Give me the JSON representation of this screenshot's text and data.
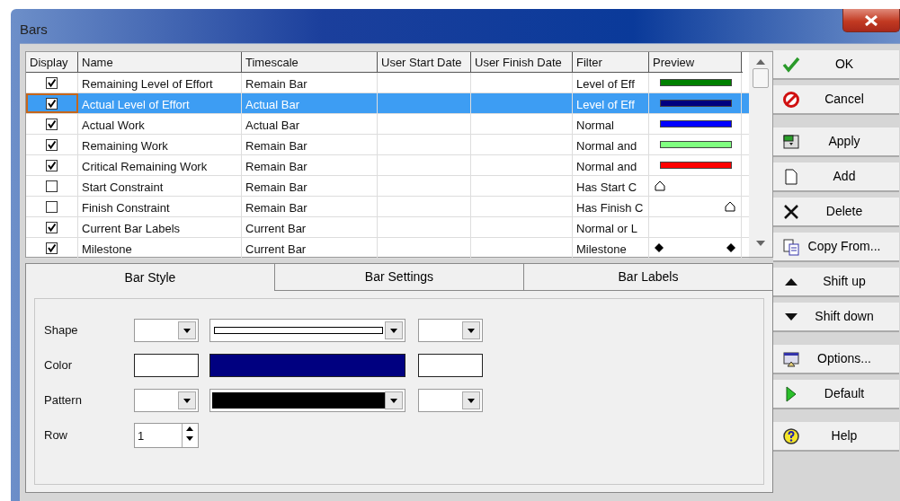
{
  "window": {
    "title": "Bars"
  },
  "table": {
    "columns": [
      "Display",
      "Name",
      "Timescale",
      "User Start Date",
      "User Finish Date",
      "Filter",
      "Preview"
    ],
    "rows": [
      {
        "display": true,
        "selected": false,
        "focused": false,
        "name": "Remaining Level of Effort",
        "timescale": "Remain Bar",
        "filter": "Level of Eff",
        "preview": {
          "kind": "bar",
          "color": "#008000"
        }
      },
      {
        "display": true,
        "selected": true,
        "focused": true,
        "name": "Actual Level of Effort",
        "timescale": "Actual Bar",
        "filter": "Level of Eff",
        "preview": {
          "kind": "bar",
          "color": "#000080"
        }
      },
      {
        "display": true,
        "selected": false,
        "focused": false,
        "name": "Actual Work",
        "timescale": "Actual Bar",
        "filter": "Normal",
        "preview": {
          "kind": "bar",
          "color": "#0000ff"
        }
      },
      {
        "display": true,
        "selected": false,
        "focused": false,
        "name": "Remaining Work",
        "timescale": "Remain Bar",
        "filter": "Normal and",
        "preview": {
          "kind": "bar",
          "color": "#80ff80"
        }
      },
      {
        "display": true,
        "selected": false,
        "focused": false,
        "name": "Critical Remaining Work",
        "timescale": "Remain Bar",
        "filter": "Normal and",
        "preview": {
          "kind": "bar",
          "color": "#ff0000"
        }
      },
      {
        "display": false,
        "selected": false,
        "focused": false,
        "name": "Start Constraint",
        "timescale": "Remain Bar",
        "filter": "Has Start C",
        "preview": {
          "kind": "start-marker"
        }
      },
      {
        "display": false,
        "selected": false,
        "focused": false,
        "name": "Finish Constraint",
        "timescale": "Remain Bar",
        "filter": "Has Finish C",
        "preview": {
          "kind": "finish-marker"
        }
      },
      {
        "display": true,
        "selected": false,
        "focused": false,
        "name": "Current Bar Labels",
        "timescale": "Current Bar",
        "filter": "Normal or L",
        "preview": {
          "kind": "none"
        }
      },
      {
        "display": true,
        "selected": false,
        "focused": false,
        "name": "Milestone",
        "timescale": "Current Bar",
        "filter": "Milestone",
        "preview": {
          "kind": "milestone"
        }
      }
    ]
  },
  "tabs": [
    {
      "label": "Bar Style",
      "selected": true
    },
    {
      "label": "Bar Settings",
      "selected": false
    },
    {
      "label": "Bar Labels",
      "selected": false
    }
  ],
  "bar_style": [
    {
      "label": "Shape",
      "kind": "pickers",
      "parts": [
        {
          "kind": "combo"
        },
        {
          "kind": "shape-combo"
        },
        {
          "kind": "combo"
        }
      ]
    },
    {
      "label": "Color",
      "kind": "pickers",
      "parts": [
        {
          "kind": "swatch",
          "color": "#ffffff"
        },
        {
          "kind": "swatch",
          "color": "#000080"
        },
        {
          "kind": "swatch",
          "color": "#ffffff"
        }
      ]
    },
    {
      "label": "Pattern",
      "kind": "pickers",
      "parts": [
        {
          "kind": "combo"
        },
        {
          "kind": "combo",
          "color": "#000000"
        },
        {
          "kind": "combo"
        }
      ]
    },
    {
      "label": "Row",
      "kind": "spinner",
      "value": "1"
    }
  ],
  "button_groups": [
    [
      "OK",
      "Cancel"
    ],
    [
      "Apply",
      "Add",
      "Delete",
      "Copy From...",
      "Shift up",
      "Shift down"
    ],
    [
      "Options...",
      "Default"
    ],
    [
      "Help"
    ]
  ]
}
